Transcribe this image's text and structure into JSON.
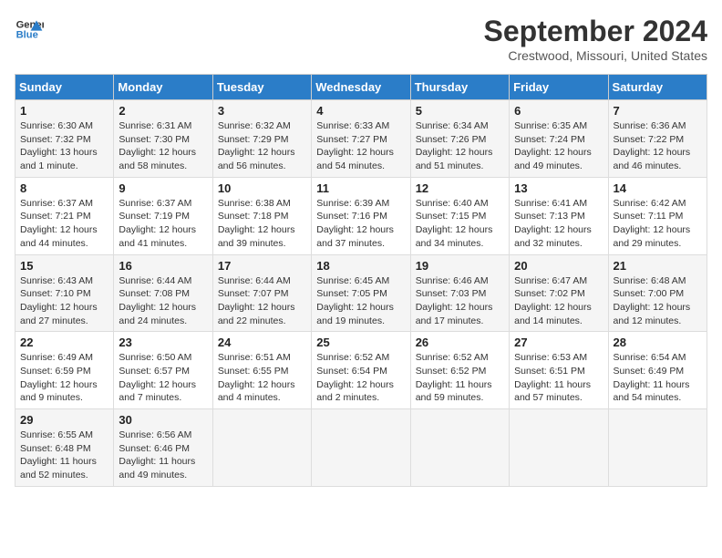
{
  "header": {
    "logo_line1": "General",
    "logo_line2": "Blue",
    "month_title": "September 2024",
    "location": "Crestwood, Missouri, United States"
  },
  "weekdays": [
    "Sunday",
    "Monday",
    "Tuesday",
    "Wednesday",
    "Thursday",
    "Friday",
    "Saturday"
  ],
  "weeks": [
    [
      {
        "day": "1",
        "sunrise": "6:30 AM",
        "sunset": "7:32 PM",
        "daylight": "13 hours and 1 minute."
      },
      {
        "day": "2",
        "sunrise": "6:31 AM",
        "sunset": "7:30 PM",
        "daylight": "12 hours and 58 minutes."
      },
      {
        "day": "3",
        "sunrise": "6:32 AM",
        "sunset": "7:29 PM",
        "daylight": "12 hours and 56 minutes."
      },
      {
        "day": "4",
        "sunrise": "6:33 AM",
        "sunset": "7:27 PM",
        "daylight": "12 hours and 54 minutes."
      },
      {
        "day": "5",
        "sunrise": "6:34 AM",
        "sunset": "7:26 PM",
        "daylight": "12 hours and 51 minutes."
      },
      {
        "day": "6",
        "sunrise": "6:35 AM",
        "sunset": "7:24 PM",
        "daylight": "12 hours and 49 minutes."
      },
      {
        "day": "7",
        "sunrise": "6:36 AM",
        "sunset": "7:22 PM",
        "daylight": "12 hours and 46 minutes."
      }
    ],
    [
      {
        "day": "8",
        "sunrise": "6:37 AM",
        "sunset": "7:21 PM",
        "daylight": "12 hours and 44 minutes."
      },
      {
        "day": "9",
        "sunrise": "6:37 AM",
        "sunset": "7:19 PM",
        "daylight": "12 hours and 41 minutes."
      },
      {
        "day": "10",
        "sunrise": "6:38 AM",
        "sunset": "7:18 PM",
        "daylight": "12 hours and 39 minutes."
      },
      {
        "day": "11",
        "sunrise": "6:39 AM",
        "sunset": "7:16 PM",
        "daylight": "12 hours and 37 minutes."
      },
      {
        "day": "12",
        "sunrise": "6:40 AM",
        "sunset": "7:15 PM",
        "daylight": "12 hours and 34 minutes."
      },
      {
        "day": "13",
        "sunrise": "6:41 AM",
        "sunset": "7:13 PM",
        "daylight": "12 hours and 32 minutes."
      },
      {
        "day": "14",
        "sunrise": "6:42 AM",
        "sunset": "7:11 PM",
        "daylight": "12 hours and 29 minutes."
      }
    ],
    [
      {
        "day": "15",
        "sunrise": "6:43 AM",
        "sunset": "7:10 PM",
        "daylight": "12 hours and 27 minutes."
      },
      {
        "day": "16",
        "sunrise": "6:44 AM",
        "sunset": "7:08 PM",
        "daylight": "12 hours and 24 minutes."
      },
      {
        "day": "17",
        "sunrise": "6:44 AM",
        "sunset": "7:07 PM",
        "daylight": "12 hours and 22 minutes."
      },
      {
        "day": "18",
        "sunrise": "6:45 AM",
        "sunset": "7:05 PM",
        "daylight": "12 hours and 19 minutes."
      },
      {
        "day": "19",
        "sunrise": "6:46 AM",
        "sunset": "7:03 PM",
        "daylight": "12 hours and 17 minutes."
      },
      {
        "day": "20",
        "sunrise": "6:47 AM",
        "sunset": "7:02 PM",
        "daylight": "12 hours and 14 minutes."
      },
      {
        "day": "21",
        "sunrise": "6:48 AM",
        "sunset": "7:00 PM",
        "daylight": "12 hours and 12 minutes."
      }
    ],
    [
      {
        "day": "22",
        "sunrise": "6:49 AM",
        "sunset": "6:59 PM",
        "daylight": "12 hours and 9 minutes."
      },
      {
        "day": "23",
        "sunrise": "6:50 AM",
        "sunset": "6:57 PM",
        "daylight": "12 hours and 7 minutes."
      },
      {
        "day": "24",
        "sunrise": "6:51 AM",
        "sunset": "6:55 PM",
        "daylight": "12 hours and 4 minutes."
      },
      {
        "day": "25",
        "sunrise": "6:52 AM",
        "sunset": "6:54 PM",
        "daylight": "12 hours and 2 minutes."
      },
      {
        "day": "26",
        "sunrise": "6:52 AM",
        "sunset": "6:52 PM",
        "daylight": "11 hours and 59 minutes."
      },
      {
        "day": "27",
        "sunrise": "6:53 AM",
        "sunset": "6:51 PM",
        "daylight": "11 hours and 57 minutes."
      },
      {
        "day": "28",
        "sunrise": "6:54 AM",
        "sunset": "6:49 PM",
        "daylight": "11 hours and 54 minutes."
      }
    ],
    [
      {
        "day": "29",
        "sunrise": "6:55 AM",
        "sunset": "6:48 PM",
        "daylight": "11 hours and 52 minutes."
      },
      {
        "day": "30",
        "sunrise": "6:56 AM",
        "sunset": "6:46 PM",
        "daylight": "11 hours and 49 minutes."
      },
      null,
      null,
      null,
      null,
      null
    ]
  ]
}
